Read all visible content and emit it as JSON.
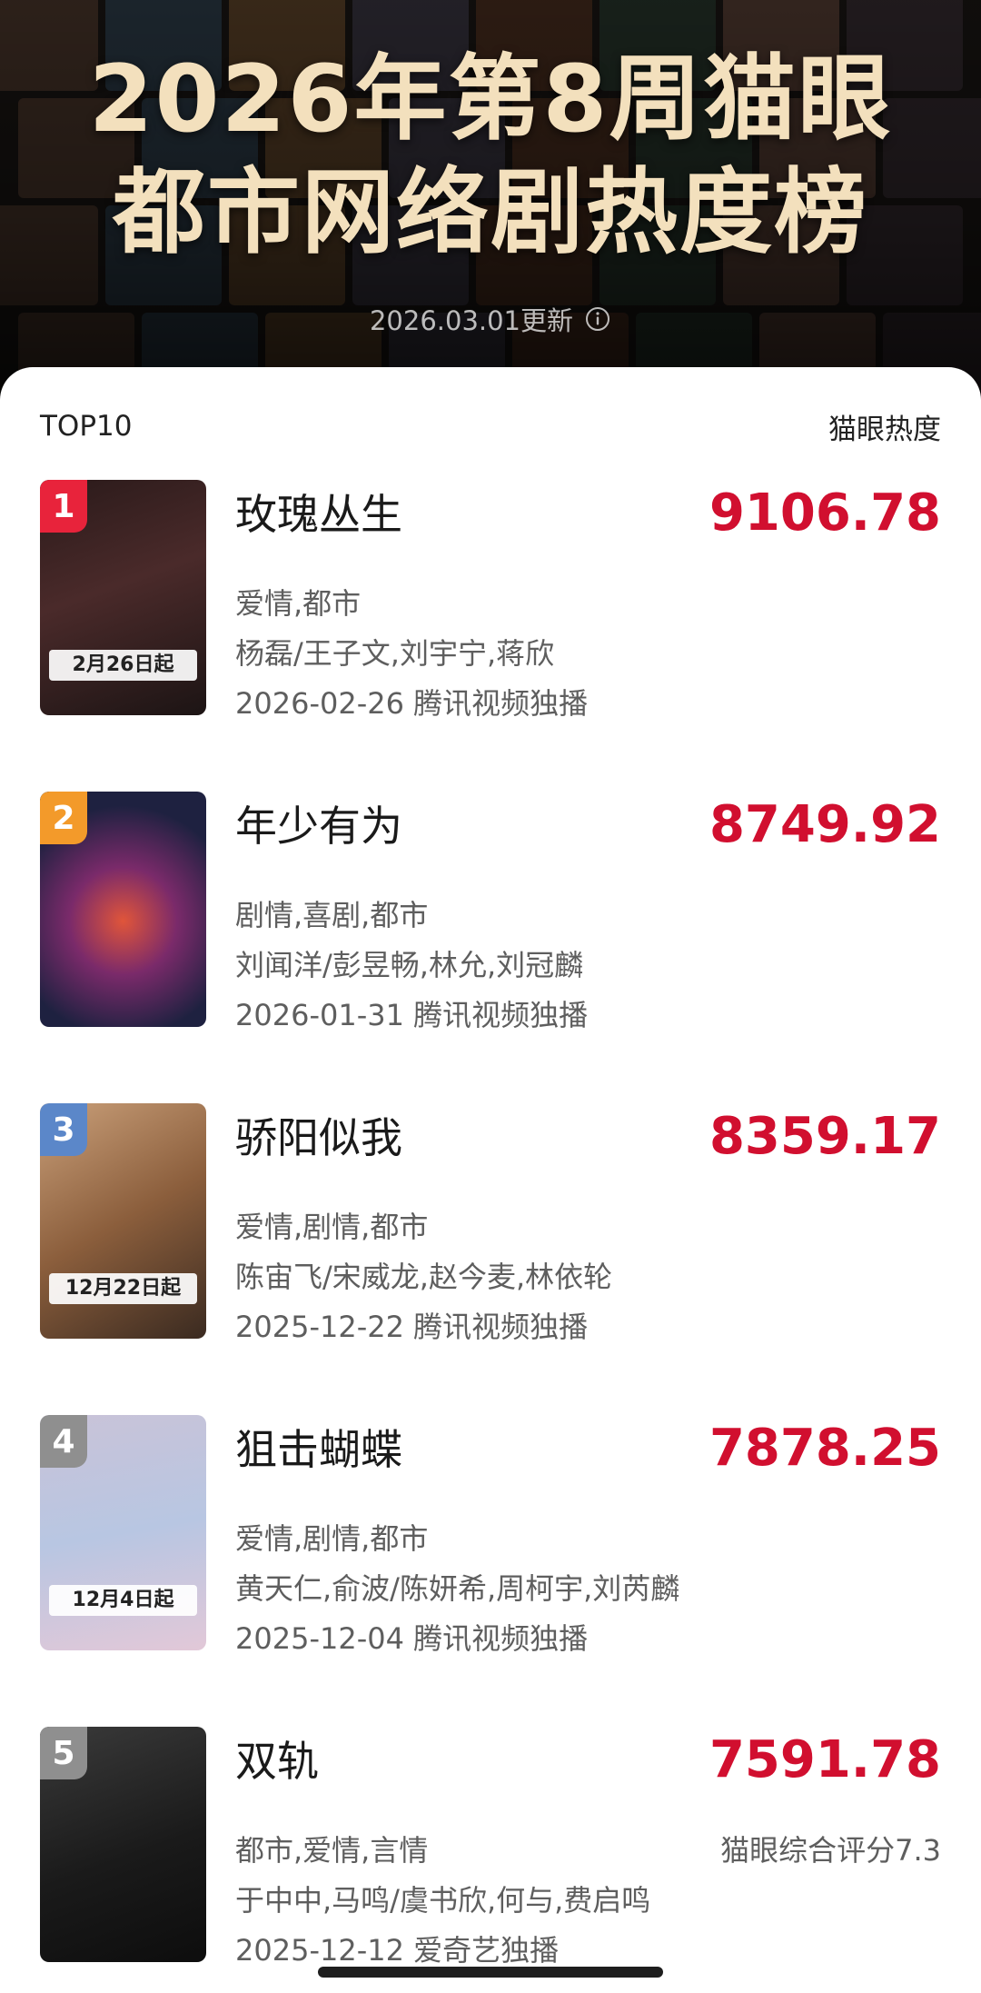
{
  "header": {
    "title_line1": "2026年第8周猫眼",
    "title_line2": "都市网络剧热度榜",
    "update_text": "2026.03.01更新",
    "info_icon": "info-circle-icon"
  },
  "list": {
    "left_label": "TOP10",
    "right_label": "猫眼热度"
  },
  "items": [
    {
      "rank": "1",
      "title": "玫瑰丛生",
      "score": "9106.78",
      "genres": "爱情,都市",
      "cast": "杨磊/王子文,刘宇宁,蒋欣",
      "release": "2026-02-26 腾讯视频独播",
      "poster_caption": "2月26日起",
      "rank_color": "#e8233b"
    },
    {
      "rank": "2",
      "title": "年少有为",
      "score": "8749.92",
      "genres": "剧情,喜剧,都市",
      "cast": "刘闻洋/彭昱畅,林允,刘冠麟",
      "release": "2026-01-31 腾讯视频独播",
      "poster_caption": "",
      "rank_color": "#f39a2a"
    },
    {
      "rank": "3",
      "title": "骄阳似我",
      "score": "8359.17",
      "genres": "爱情,剧情,都市",
      "cast": "陈宙飞/宋威龙,赵今麦,林依轮",
      "release": "2025-12-22 腾讯视频独播",
      "poster_caption": "12月22日起",
      "rank_color": "#5b87c9"
    },
    {
      "rank": "4",
      "title": "狙击蝴蝶",
      "score": "7878.25",
      "genres": "爱情,剧情,都市",
      "cast": "黄天仁,俞波/陈妍希,周柯宇,刘芮麟",
      "release": "2025-12-04 腾讯视频独播",
      "poster_caption": "12月4日起",
      "rank_color": "#8f8f8f"
    },
    {
      "rank": "5",
      "title": "双轨",
      "score": "7591.78",
      "genres": "都市,爱情,言情",
      "cast": "于中中,马鸣/虞书欣,何与,费启鸣",
      "release": "2025-12-12 爱奇艺独播",
      "poster_caption": "",
      "rank_color": "#8f8f8f",
      "rating": "猫眼综合评分7.3"
    }
  ]
}
